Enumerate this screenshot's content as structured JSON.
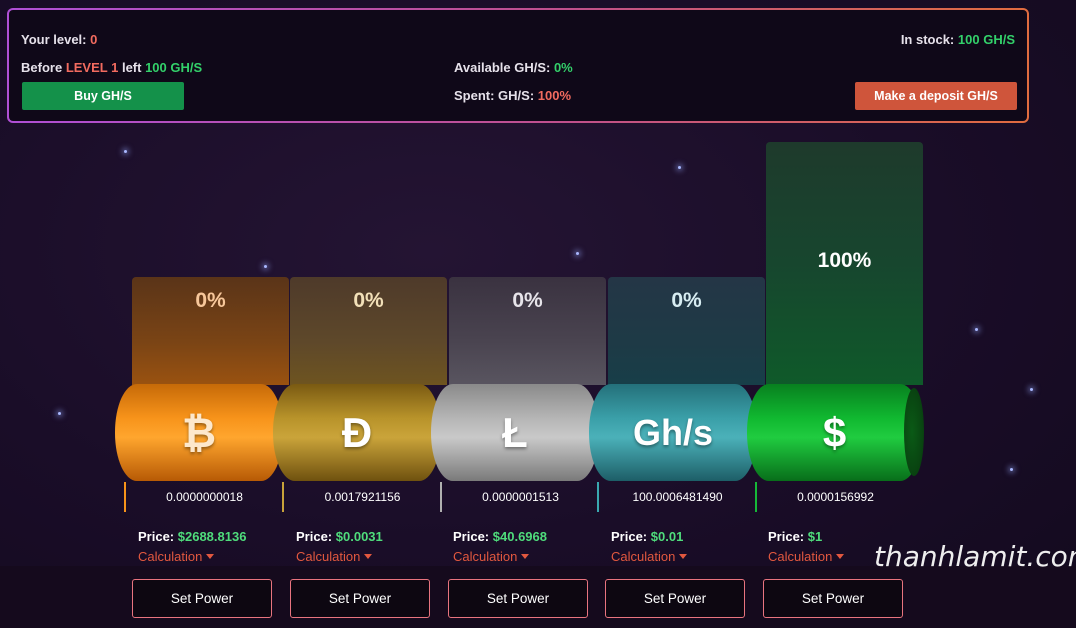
{
  "header": {
    "level_label": "Your level:",
    "level_value": "0",
    "before_label": "Before",
    "next_level": "LEVEL 1",
    "left_label": "left",
    "left_value": "100 GH/S",
    "buy_button": "Buy GH/S",
    "available_label": "Available GH/S:",
    "available_value": "0%",
    "spent_label": "Spent: GH/S:",
    "spent_value": "100%",
    "stock_label": "In stock:",
    "stock_value": "100 GH/S",
    "deposit_button": "Make a deposit GH/S"
  },
  "coins": [
    {
      "symbol": "₿",
      "percent": "0%",
      "balance": "0.0000000018",
      "price_label": "Price:",
      "price": "$2688.8136",
      "calc": "Calculation",
      "set_power": "Set Power"
    },
    {
      "symbol": "Đ",
      "percent": "0%",
      "balance": "0.0017921156",
      "price_label": "Price:",
      "price": "$0.0031",
      "calc": "Calculation",
      "set_power": "Set Power"
    },
    {
      "symbol": "Ł",
      "percent": "0%",
      "balance": "0.0000001513",
      "price_label": "Price:",
      "price": "$40.6968",
      "calc": "Calculation",
      "set_power": "Set Power"
    },
    {
      "symbol": "Gh/s",
      "percent": "0%",
      "balance": "100.0006481490",
      "price_label": "Price:",
      "price": "$0.01",
      "calc": "Calculation",
      "set_power": "Set Power"
    },
    {
      "symbol": "$",
      "percent": "100%",
      "balance": "0.0000156992",
      "price_label": "Price:",
      "price": "$1",
      "calc": "Calculation",
      "set_power": "Set Power"
    }
  ],
  "watermark": "thanhlamit.com",
  "colors": {
    "accent_green": "#14914a",
    "accent_red": "#cf553b",
    "btc": "#f7931a",
    "doge": "#b8932a",
    "ltc": "#a8a8a8",
    "ghs": "#3a9fa8",
    "usd": "#10b830"
  }
}
